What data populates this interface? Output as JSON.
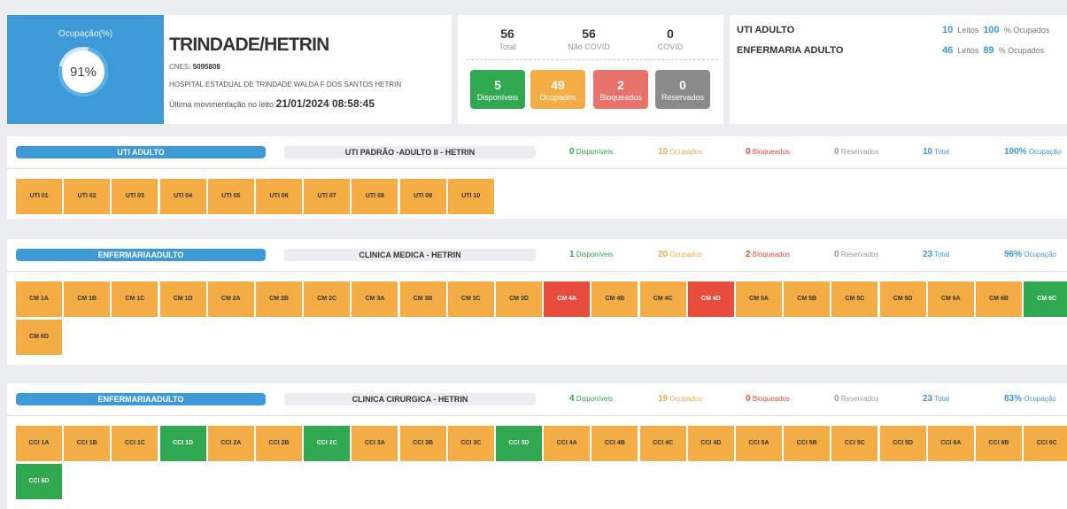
{
  "occupancy": {
    "title": "Ocupação(%)",
    "value": "91%"
  },
  "hospital": {
    "name": "TRINDADE/HETRIN",
    "cnes_label": "CNES:",
    "cnes_value": "5095808",
    "full_name": "HOSPITAL ESTADUAL DE TRINDADE WALDA F DOS SANTOS HETRIN",
    "last_move_label": "Última movimentação no leito:",
    "last_move_value": "21/01/2024 08:58:45"
  },
  "stats": {
    "total": {
      "value": "56",
      "label": "Total"
    },
    "non_covid": {
      "value": "56",
      "label": "Não COVID"
    },
    "covid": {
      "value": "0",
      "label": "COVID"
    },
    "available": {
      "value": "5",
      "label": "Disponíveis"
    },
    "occupied": {
      "value": "49",
      "label": "Ocupados"
    },
    "blocked": {
      "value": "2",
      "label": "Bloqueados"
    },
    "reserved": {
      "value": "0",
      "label": "Reservados"
    }
  },
  "summary": [
    {
      "name": "UTI ADULTO",
      "beds": "10",
      "beds_label": "Leitos",
      "pct": "100",
      "pct_label": "% Ocupados"
    },
    {
      "name": "ENFERMARIA ADULTO",
      "beds": "46",
      "beds_label": "Leitos",
      "pct": "89",
      "pct_label": "% Ocupados"
    }
  ],
  "colors": {
    "blue": "#3d9ad6",
    "green": "#2fa84f",
    "orange": "#f4ac45",
    "red": "#e74c3c",
    "gray": "#8a8a8a"
  },
  "sections": [
    {
      "type": "UTI ADULTO",
      "unit": "UTI PADRÃO -ADULTO II - HETRIN",
      "available": "0",
      "available_label": "Disponíveis",
      "occupied": "10",
      "occupied_label": "Ocupados",
      "blocked": "0",
      "blocked_label": "Bloqueados",
      "reserved": "0",
      "reserved_label": "Reservados",
      "total": "10",
      "total_label": "Total",
      "occupancy": "100%",
      "occupancy_label": "Ocupação",
      "beds": [
        {
          "label": "UTI 01",
          "status": "occ"
        },
        {
          "label": "UTI 02",
          "status": "occ"
        },
        {
          "label": "UTI 03",
          "status": "occ"
        },
        {
          "label": "UTI 04",
          "status": "occ"
        },
        {
          "label": "UTI 05",
          "status": "occ"
        },
        {
          "label": "UTI 06",
          "status": "occ"
        },
        {
          "label": "UTI 07",
          "status": "occ"
        },
        {
          "label": "UTI 08",
          "status": "occ"
        },
        {
          "label": "UTI 09",
          "status": "occ"
        },
        {
          "label": "UTI 10",
          "status": "occ"
        }
      ]
    },
    {
      "type": "ENFERMARIAADULTO",
      "unit": "CLINICA MEDICA - HETRIN",
      "available": "1",
      "available_label": "Disponíveis",
      "occupied": "20",
      "occupied_label": "Ocupados",
      "blocked": "2",
      "blocked_label": "Bloqueados",
      "reserved": "0",
      "reserved_label": "Reservados",
      "total": "23",
      "total_label": "Total",
      "occupancy": "96%",
      "occupancy_label": "Ocupação",
      "beds": [
        {
          "label": "CM 1A",
          "status": "occ"
        },
        {
          "label": "CM 1B",
          "status": "occ"
        },
        {
          "label": "CM 1C",
          "status": "occ"
        },
        {
          "label": "CM 1D",
          "status": "occ"
        },
        {
          "label": "CM 2A",
          "status": "occ"
        },
        {
          "label": "CM 2B",
          "status": "occ"
        },
        {
          "label": "CM 2C",
          "status": "occ"
        },
        {
          "label": "CM 3A",
          "status": "occ"
        },
        {
          "label": "CM 3B",
          "status": "occ"
        },
        {
          "label": "CM 3C",
          "status": "occ"
        },
        {
          "label": "CM 3D",
          "status": "occ"
        },
        {
          "label": "CM 4A",
          "status": "blk"
        },
        {
          "label": "CM 4B",
          "status": "occ"
        },
        {
          "label": "CM 4C",
          "status": "occ"
        },
        {
          "label": "CM 4D",
          "status": "blk"
        },
        {
          "label": "CM 5A",
          "status": "occ"
        },
        {
          "label": "CM 5B",
          "status": "occ"
        },
        {
          "label": "CM 5C",
          "status": "occ"
        },
        {
          "label": "CM 5D",
          "status": "occ"
        },
        {
          "label": "CM 6A",
          "status": "occ"
        },
        {
          "label": "CM 6B",
          "status": "occ"
        },
        {
          "label": "CM 6C",
          "status": "free"
        },
        {
          "label": "CM 6D",
          "status": "occ"
        }
      ]
    },
    {
      "type": "ENFERMARIAADULTO",
      "unit": "CLINICA CIRURGICA - HETRIN",
      "available": "4",
      "available_label": "Disponíveis",
      "occupied": "19",
      "occupied_label": "Ocupados",
      "blocked": "0",
      "blocked_label": "Bloqueados",
      "reserved": "0",
      "reserved_label": "Reservados",
      "total": "23",
      "total_label": "Total",
      "occupancy": "83%",
      "occupancy_label": "Ocupação",
      "beds": [
        {
          "label": "CCI 1A",
          "status": "occ"
        },
        {
          "label": "CCI 1B",
          "status": "occ"
        },
        {
          "label": "CCI 1C",
          "status": "occ"
        },
        {
          "label": "CCI 1D",
          "status": "free"
        },
        {
          "label": "CCI 2A",
          "status": "occ"
        },
        {
          "label": "CCI 2B",
          "status": "occ"
        },
        {
          "label": "CCI 2C",
          "status": "free"
        },
        {
          "label": "CCI 3A",
          "status": "occ"
        },
        {
          "label": "CCI 3B",
          "status": "occ"
        },
        {
          "label": "CCI 3C",
          "status": "occ"
        },
        {
          "label": "CCI 3D",
          "status": "free"
        },
        {
          "label": "CCI 4A",
          "status": "occ"
        },
        {
          "label": "CCI 4B",
          "status": "occ"
        },
        {
          "label": "CCI 4C",
          "status": "occ"
        },
        {
          "label": "CCI 4D",
          "status": "occ"
        },
        {
          "label": "CCI 5A",
          "status": "occ"
        },
        {
          "label": "CCI 5B",
          "status": "occ"
        },
        {
          "label": "CCI 5C",
          "status": "occ"
        },
        {
          "label": "CCI 5D",
          "status": "occ"
        },
        {
          "label": "CCI 6A",
          "status": "occ"
        },
        {
          "label": "CCI 6B",
          "status": "occ"
        },
        {
          "label": "CCI 6C",
          "status": "occ"
        },
        {
          "label": "CCI 6D",
          "status": "free"
        }
      ]
    }
  ]
}
